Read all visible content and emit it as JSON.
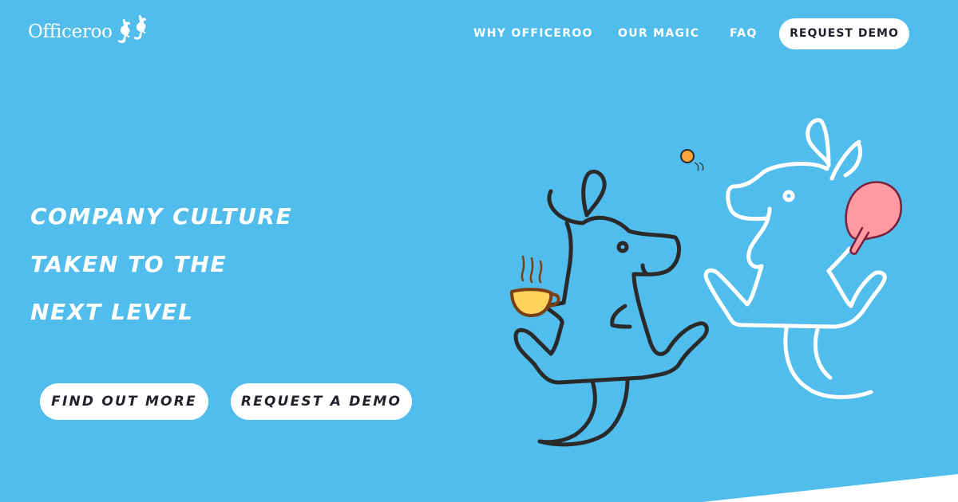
{
  "brand": {
    "name": "Officeroo",
    "logo_icon": "two-kangaroos-icon"
  },
  "nav": {
    "links": [
      "WHY OFFICEROO",
      "OUR MAGIC",
      "FAQ"
    ],
    "cta": "REQUEST DEMO"
  },
  "hero": {
    "headline": [
      "COMPANY CULTURE",
      "TAKEN TO THE",
      "NEXT LEVEL"
    ],
    "buttons": [
      "FIND OUT MORE",
      "REQUEST A DEMO"
    ]
  },
  "illustration": {
    "left_character": "kangaroo-with-coffee-icon",
    "right_character": "kangaroo-with-ping-pong-paddle-icon"
  },
  "colors": {
    "background": "#50bdec",
    "text": "#ffffff",
    "button_bg": "#ffffff",
    "button_text": "#1f1f2d",
    "outline_dark": "#2a2a2a",
    "paddle": "#ff9aa2",
    "cup": "#ffd35c",
    "ball": "#f6a63c"
  }
}
